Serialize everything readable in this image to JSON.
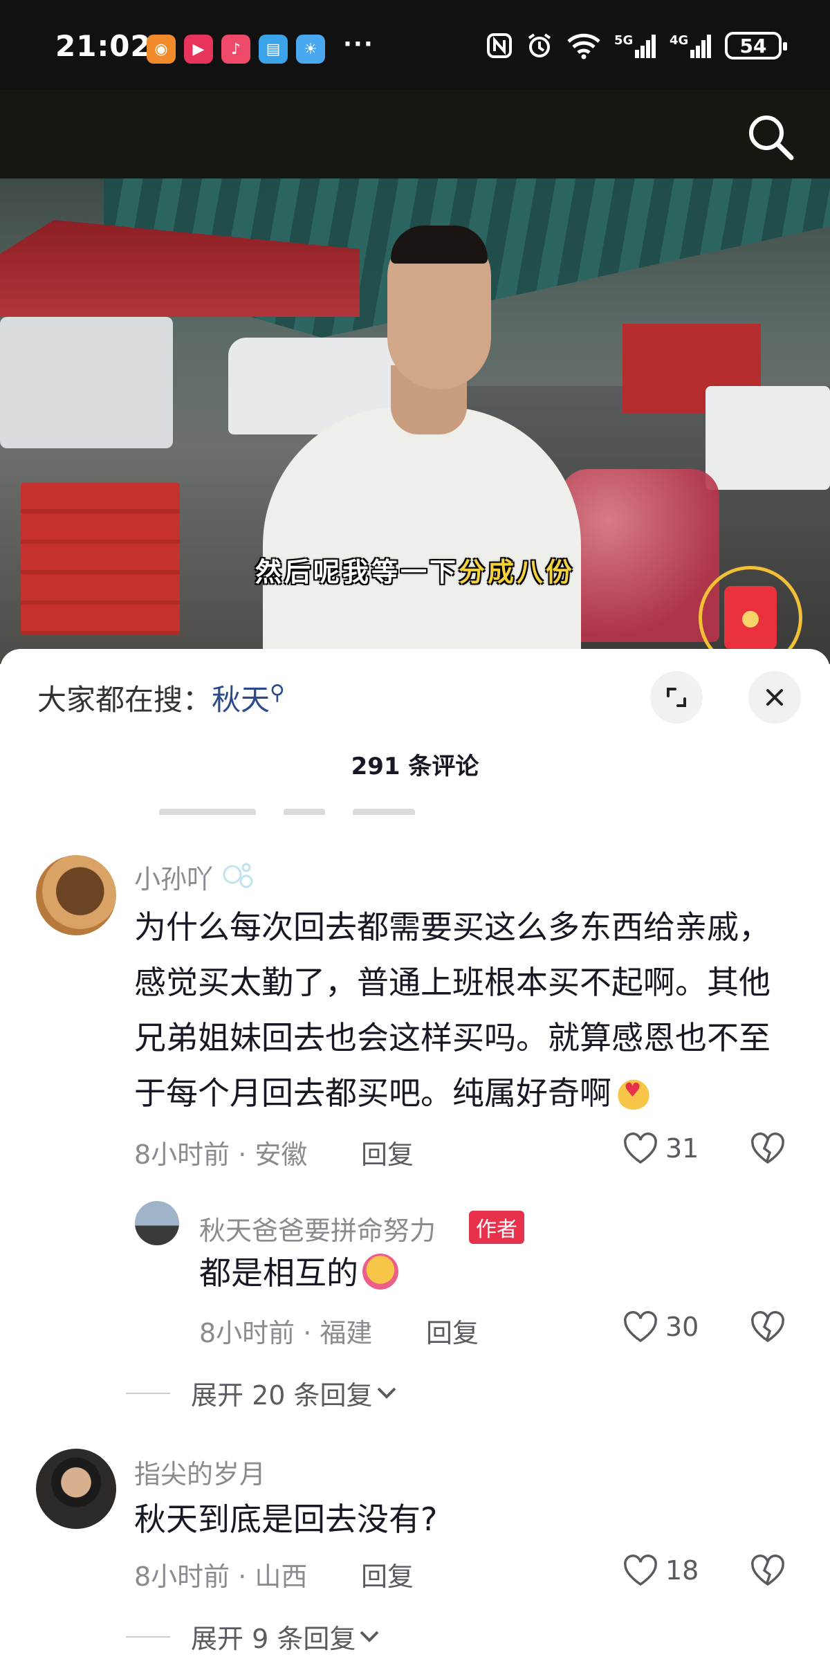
{
  "status_bar": {
    "time": "21:02",
    "more": "···",
    "battery": "54",
    "app_icons": [
      {
        "icon": "app-orange-icon",
        "color": "#f08a2a"
      },
      {
        "icon": "app-video-icon",
        "color": "#e8335a"
      },
      {
        "icon": "app-music-icon",
        "color": "#f04a6a"
      },
      {
        "icon": "app-book-icon",
        "color": "#3ba3e8"
      },
      {
        "icon": "app-weather-icon",
        "color": "#4aa8f0"
      }
    ]
  },
  "video": {
    "subtitle_plain": "然后呢我等一下",
    "subtitle_highlight": "分成八份"
  },
  "comments_panel": {
    "hot_search_prefix": "大家都在搜：",
    "hot_search_keyword": "秋天",
    "count_label": "291 条评论",
    "comments": [
      {
        "username": "小孙吖",
        "text": "为什么每次回去都需要买这么多东西给亲戚，感觉买太勤了，普通上班根本买不起啊。其他兄弟姐妹回去也会这样买吗。就算感恩也不至于每个月回去都买吧。纯属好奇啊",
        "meta": "8小时前 · 安徽",
        "reply_label": "回复",
        "likes": "31",
        "sub_reply": {
          "username": "秋天爸爸要拼命努力",
          "badge": "作者",
          "text": "都是相互的",
          "meta": "8小时前 · 福建",
          "reply_label": "回复",
          "likes": "30"
        },
        "expand_label": "展开 20 条回复"
      },
      {
        "username": "指尖的岁月",
        "text": "秋天到底是回去没有?",
        "meta": "8小时前 · 山西",
        "reply_label": "回复",
        "likes": "18",
        "expand_label": "展开 9 条回复"
      }
    ]
  }
}
